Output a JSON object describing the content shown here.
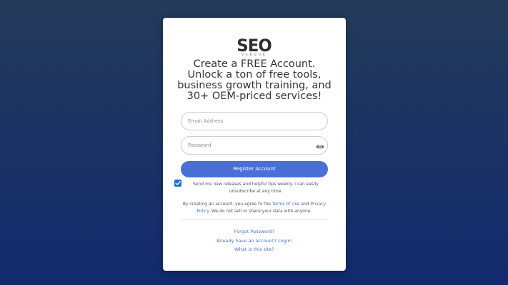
{
  "brand": {
    "logo_text": "SEO",
    "logo_subtext": "VENDOR"
  },
  "headline": "Create a FREE Account. Unlock a ton of free tools, business growth training, and 30+ OEM-priced services!",
  "form": {
    "email_placeholder": "Email Address",
    "password_placeholder": "Password",
    "register_label": "Register Account",
    "consent_checked": true,
    "consent_text": "Send me new releases and helpful tips weekly. I can easily unsubscribe at any time."
  },
  "terms": {
    "prefix": "By creating an account, you agree to the ",
    "terms_link": "Terms of Use",
    "middle": " and ",
    "privacy_link": "Privacy Policy",
    "suffix": ". We do not sell or share your data with anyone."
  },
  "links": {
    "forgot": "Forgot Password?",
    "login": "Already have an account? Login!",
    "about": "What is this site?"
  },
  "colors": {
    "accent": "#4a6fd6",
    "checkbox": "#1f6fd4",
    "background_top": "#243a5a",
    "background_bottom": "#122a6e"
  }
}
